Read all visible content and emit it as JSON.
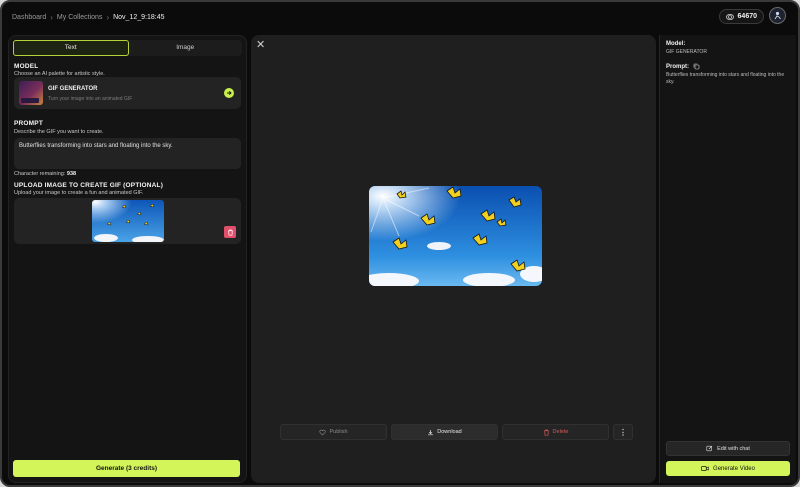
{
  "breadcrumb": {
    "items": [
      "Dashboard",
      "My Collections"
    ],
    "current": "Nov_12_9:18:45"
  },
  "credits": {
    "value": "64670"
  },
  "tabs": [
    {
      "label": "Text",
      "active": true
    },
    {
      "label": "Image",
      "active": false
    }
  ],
  "model": {
    "heading": "MODEL",
    "subheading": "Choose an AI palette for artistic style.",
    "name": "GIF GENERATOR",
    "description": "Turn your image into an animated GIF"
  },
  "prompt": {
    "heading": "PROMPT",
    "subheading": "Describe the GIF you want to create.",
    "value": "Butterflies transforming into stars and floating into the sky.",
    "remaining_label": "Character remaining:",
    "remaining_value": "938"
  },
  "upload": {
    "heading": "UPLOAD IMAGE TO CREATE GIF (OPTIONAL)",
    "subheading": "Upload your image to create a fun and animated GIF."
  },
  "generate_button": "Generate (3 credits)",
  "actions": {
    "publish": "Publish",
    "download": "Download",
    "delete": "Delete"
  },
  "details": {
    "model_label": "Model:",
    "model_value": "GIF GENERATOR",
    "prompt_label": "Prompt:",
    "prompt_value": "Butterflies transforming into stars and floating into the sky."
  },
  "edit_button": "Edit with chat",
  "video_button": "Generate Video",
  "colors": {
    "accent": "#d4f55a",
    "delete": "#d85a5a",
    "background": "#0b0b0b",
    "panel": "#141414"
  },
  "icons": [
    "chevron-right-icon",
    "coin-icon",
    "avatar-icon",
    "arrow-right-icon",
    "trash-icon",
    "close-icon",
    "heart-icon",
    "download-icon",
    "more-vertical-icon",
    "copy-icon",
    "edit-icon",
    "video-icon"
  ]
}
